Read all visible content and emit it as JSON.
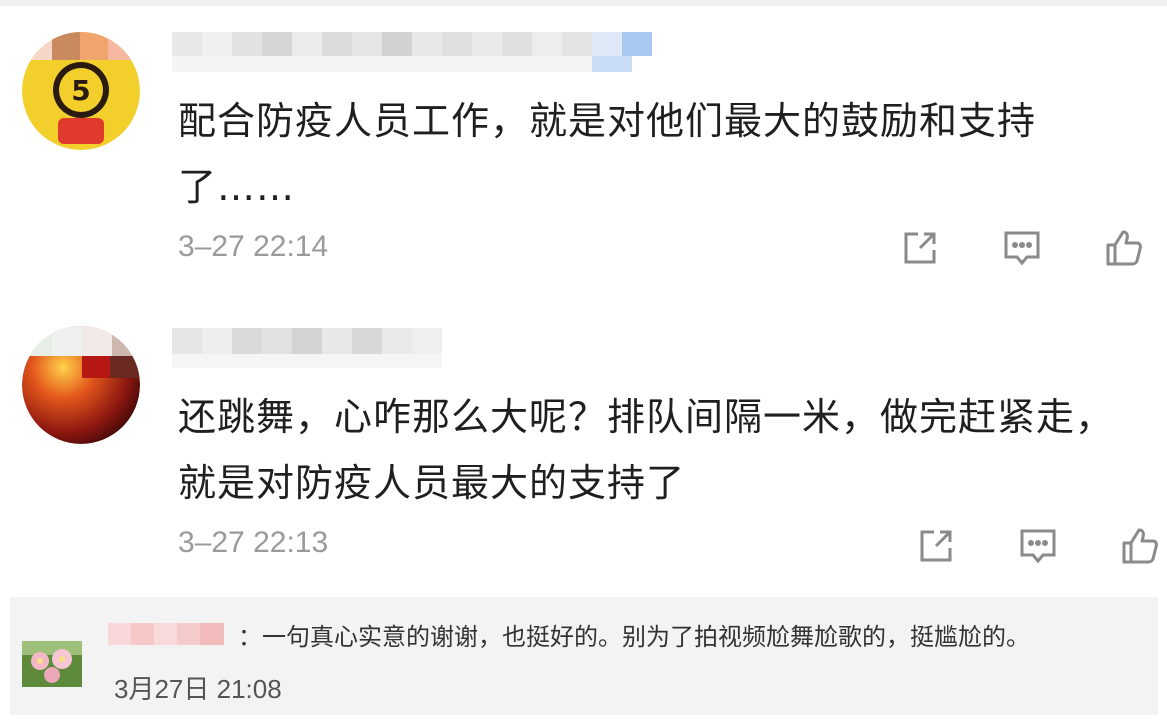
{
  "comments": [
    {
      "content": "配合防疫人员工作，就是对他们最大的鼓励和支持了……",
      "time": "3–27 22:14"
    },
    {
      "content": "还跳舞，心咋那么大呢？排队间隔一米，做完赶紧走，就是对防疫人员最大的支持了",
      "time": "3–27 22:13"
    }
  ],
  "reply": {
    "text": "：一句真心实意的谢谢，也挺好的。别为了拍视频尬舞尬歌的，挺尴尬的。",
    "time": "3月27日 21:08"
  },
  "icons": {
    "share": "share-icon",
    "comment": "comment-icon",
    "like": "thumbs-up-icon"
  },
  "colors": {
    "text": "#1f1f1f",
    "time": "#9a9a9a",
    "icon": "#8a8a8a",
    "reply_bg": "#f3f3f3"
  }
}
